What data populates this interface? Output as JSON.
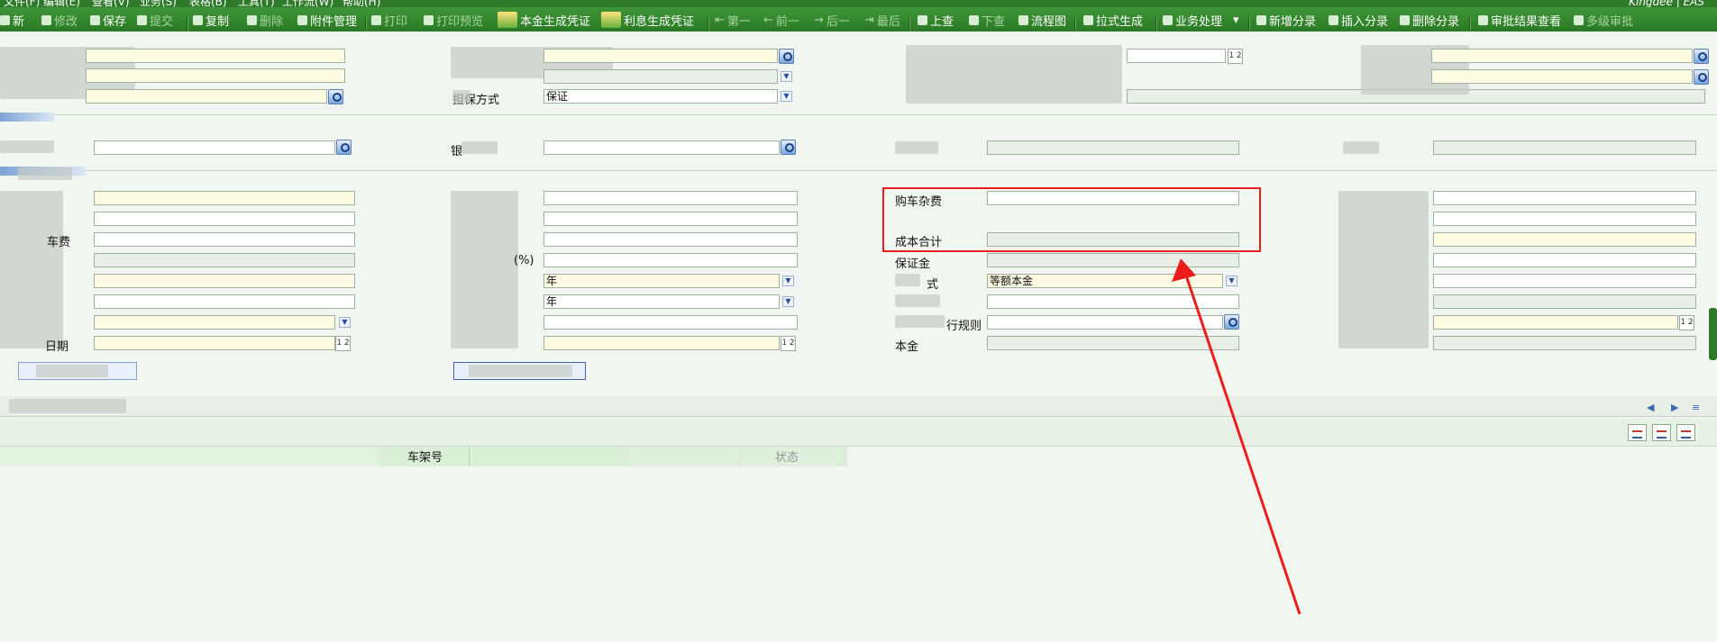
{
  "menu": [
    "文件(F)",
    "编辑(E)",
    "查看(V)",
    "业务(S)",
    "表格(B)",
    "工具(T)",
    "工作流(W)",
    "帮助(H)"
  ],
  "brand": "Kingdee | EAS",
  "toolbar": {
    "new": "新",
    "modify": "修改",
    "save": "保存",
    "submit": "提交",
    "copy": "复制",
    "delete": "删除",
    "attachment": "附件管理",
    "print": "打印",
    "print_preview": "打印预览",
    "principal_voucher": "本金生成凭证",
    "interest_voucher": "利息生成凭证",
    "first": "第一",
    "prev": "前一",
    "next": "后一",
    "last": "最后",
    "up_query": "上查",
    "down_query": "下查",
    "flowchart": "流程图",
    "pull_generate": "拉式生成",
    "business_process": "业务处理",
    "add_entry": "新增分录",
    "insert_entry": "插入分录",
    "delete_entry": "删除分录",
    "approval_view": "审批结果查看",
    "multi_approval": "多级审批"
  },
  "form": {
    "guarantee_mode_label": "担保方式",
    "guarantee_mode_value": "保证",
    "car_misc_fee_partial": "车费",
    "rate_partial": "(%)",
    "year_unit_1": "年",
    "year_unit_2": "年",
    "date_partial": "日期",
    "car_misc_fee_label": "购车杂费",
    "cost_total_label": "成本合计",
    "deposit_label": "保证金",
    "repay_mode_value": "等额本金",
    "repay_mode_partial": "式",
    "exec_rule_partial": "行规则",
    "principal_partial": "本金",
    "bank_partial": "银",
    "date_icon": "1 2"
  },
  "grid": {
    "headers": [
      "车架号",
      "状态"
    ]
  },
  "colors": {
    "toolbar": "#2f7a2a",
    "highlight": "#ee1d1d",
    "arrow": "#ee1d1d"
  }
}
